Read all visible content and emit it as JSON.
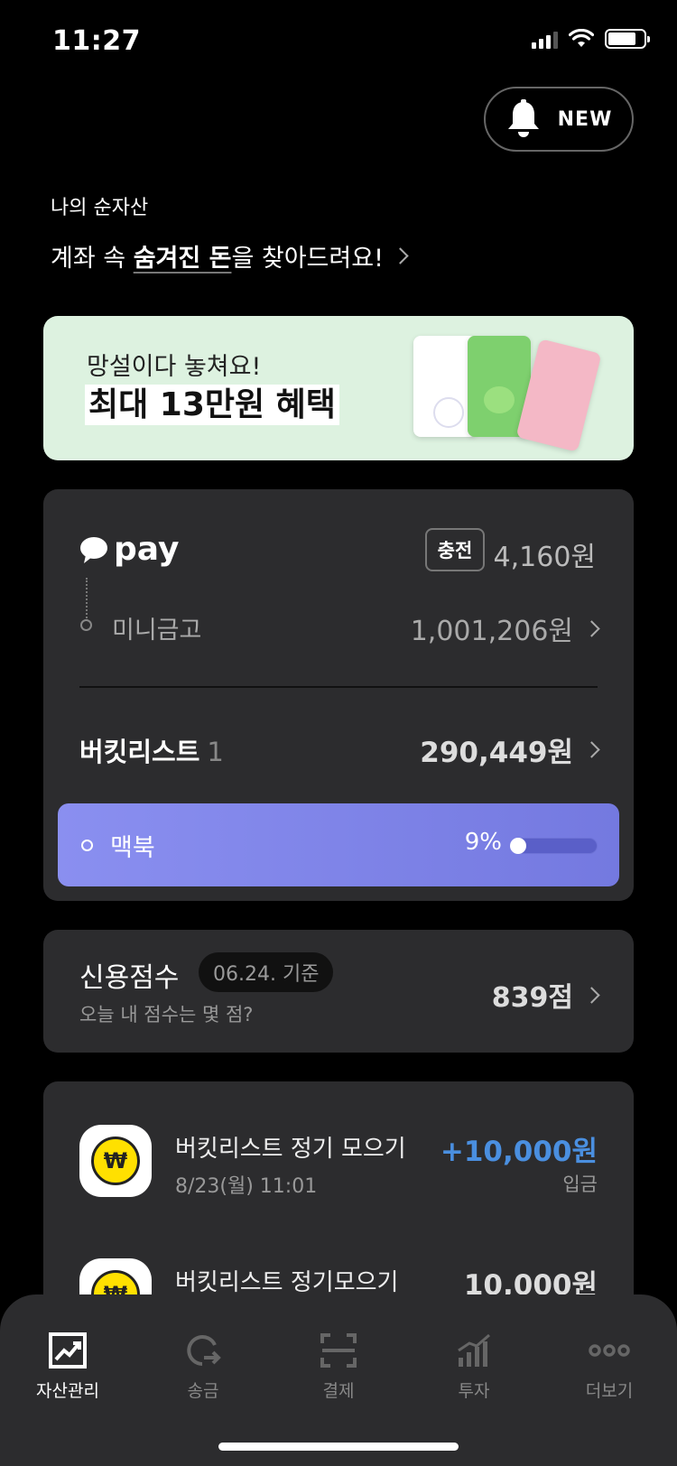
{
  "status_bar": {
    "time": "11:27"
  },
  "header": {
    "badge_label": "NEW"
  },
  "net_assets": {
    "label": "나의 순자산",
    "headline_prefix": "계좌 속 ",
    "headline_emph": "숨겨진 돈",
    "headline_suffix": "을 찾아드려요!"
  },
  "banner": {
    "subtitle": "망설이다 놓쳐요!",
    "title": "최대 13만원 혜택"
  },
  "pay": {
    "logo_text": "pay",
    "charge_label": "충전",
    "balance": "4,160원",
    "mini_label": "미니금고",
    "mini_amount": "1,001,206원"
  },
  "bucket": {
    "label": "버킷리스트",
    "count": "1",
    "amount": "290,449원",
    "goal_name": "맥북",
    "goal_percent_text": "9%",
    "goal_progress": 0.09
  },
  "credit": {
    "title": "신용점수",
    "date": "06.24. 기준",
    "subtitle": "오늘 내 점수는 몇 점?",
    "score": "839점"
  },
  "transactions": [
    {
      "title": "버킷리스트 정기 모으기",
      "date": "8/23(월) 11:01",
      "amount": "+10,000원",
      "type": "입금",
      "amount_color": "#4a8fe0",
      "icon": "won-coin-icon"
    },
    {
      "title": "버킷리스트 정기모으기",
      "date": "",
      "amount": "10,000원",
      "type": "",
      "amount_color": "#dddddd",
      "icon": "won-coin-icon"
    }
  ],
  "tabs": [
    {
      "label": "자산관리",
      "icon": "chart-up-icon",
      "active": true
    },
    {
      "label": "송금",
      "icon": "transfer-icon",
      "active": false
    },
    {
      "label": "결제",
      "icon": "scan-icon",
      "active": false
    },
    {
      "label": "투자",
      "icon": "bar-chart-icon",
      "active": false
    },
    {
      "label": "더보기",
      "icon": "more-icon",
      "active": false
    }
  ],
  "colors": {
    "background": "#000000",
    "panel": "#2c2c2e",
    "accent_blue": "#4a8fe0",
    "goal_gradient": "#8a8ff0",
    "banner_bg": "#ddf2e0"
  }
}
